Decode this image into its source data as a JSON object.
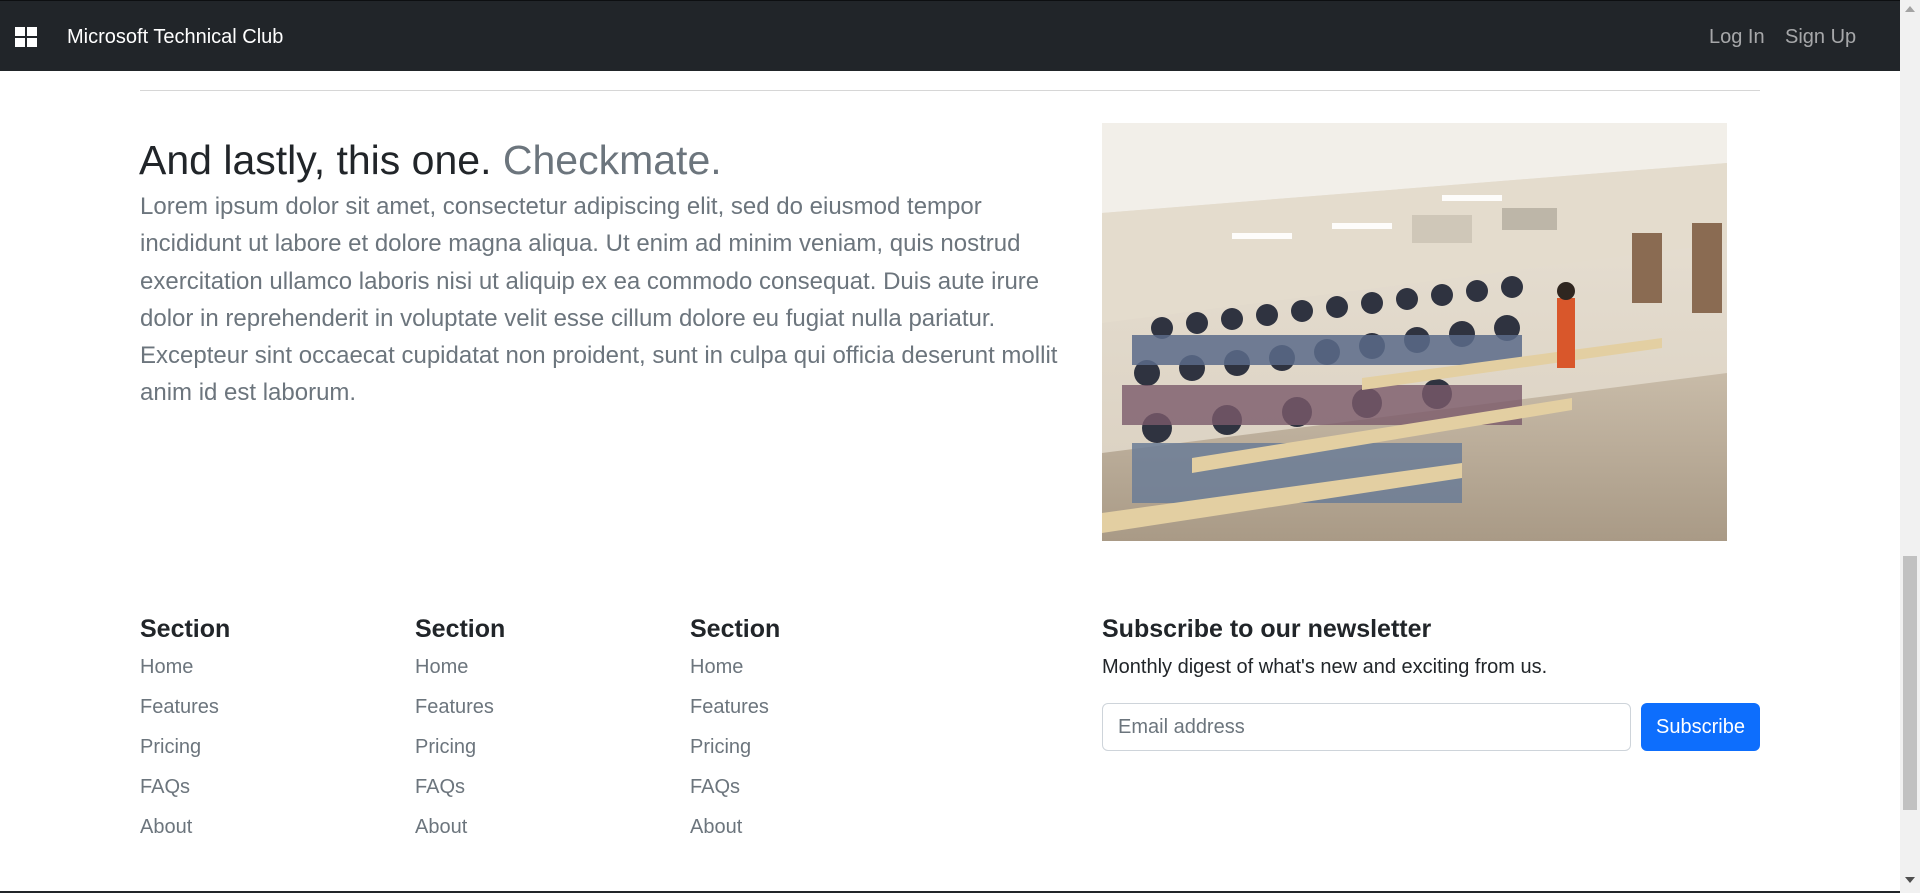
{
  "navbar": {
    "brand": "Microsoft Technical Club",
    "links": [
      {
        "label": "Log In"
      },
      {
        "label": "Sign Up"
      }
    ]
  },
  "feature": {
    "heading": "And lastly, this one.",
    "heading_muted": "Checkmate.",
    "body": "Lorem ipsum dolor sit amet, consectetur adipiscing elit, sed do eiusmod tempor incididunt ut labore et dolore magna aliqua. Ut enim ad minim veniam, quis nostrud exercitation ullamco laboris nisi ut aliquip ex ea commodo consequat. Duis aute irure dolor in reprehenderit in voluptate velit esse cillum dolore eu fugiat nulla pariatur. Excepteur sint occaecat cupidatat non proident, sunt in culpa qui officia deserunt mollit anim id est laborum."
  },
  "footer": {
    "sections": [
      {
        "title": "Section",
        "links": [
          "Home",
          "Features",
          "Pricing",
          "FAQs",
          "About"
        ]
      },
      {
        "title": "Section",
        "links": [
          "Home",
          "Features",
          "Pricing",
          "FAQs",
          "About"
        ]
      },
      {
        "title": "Section",
        "links": [
          "Home",
          "Features",
          "Pricing",
          "FAQs",
          "About"
        ]
      }
    ],
    "newsletter": {
      "title": "Subscribe to our newsletter",
      "description": "Monthly digest of what's new and exciting from us.",
      "placeholder": "Email address",
      "button": "Subscribe"
    }
  },
  "colors": {
    "navbar_bg": "#212529",
    "primary": "#0d6efd",
    "muted": "#6c757d"
  }
}
